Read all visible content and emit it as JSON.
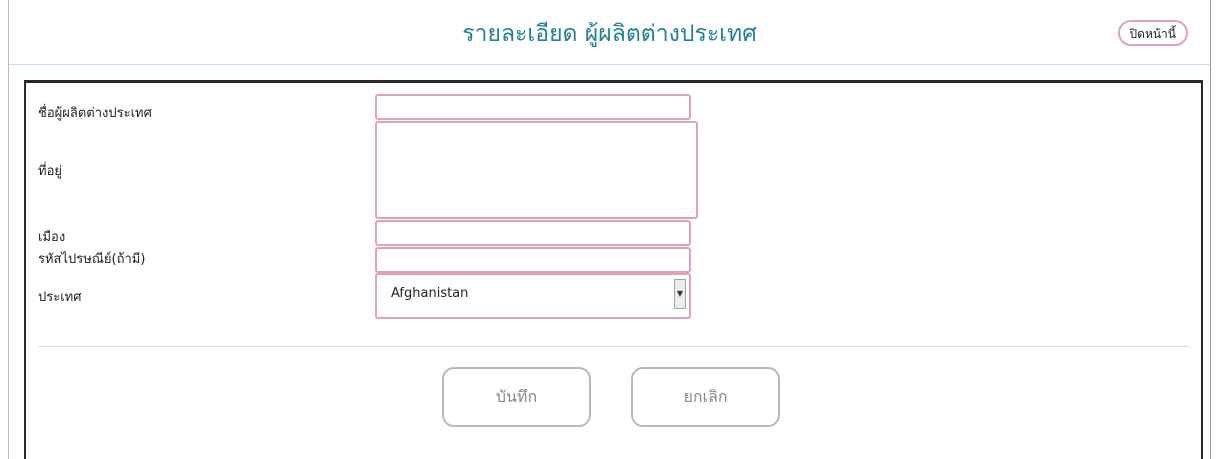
{
  "header": {
    "title": "รายละเอียด ผู้ผลิตต่างประเทศ",
    "close_label": "ปิดหน้านี้"
  },
  "form": {
    "manufacturer_name_label": "ชื่อผู้ผลิตต่างประเทศ",
    "manufacturer_name_value": "",
    "address_label": "ที่อยู่",
    "address_value": "",
    "city_label": "เมือง",
    "city_value": "",
    "postal_code_label": "รหัสไปรษณีย์(ถ้ามี)",
    "postal_code_value": "",
    "country_label": "ประเทศ",
    "country_selected": "Afghanistan"
  },
  "actions": {
    "save_label": "บันทึก",
    "cancel_label": "ยกเลิก"
  },
  "colors": {
    "title": "#1f7f96",
    "field_border": "#e2a1b9",
    "button_border": "#b8b8b8"
  }
}
